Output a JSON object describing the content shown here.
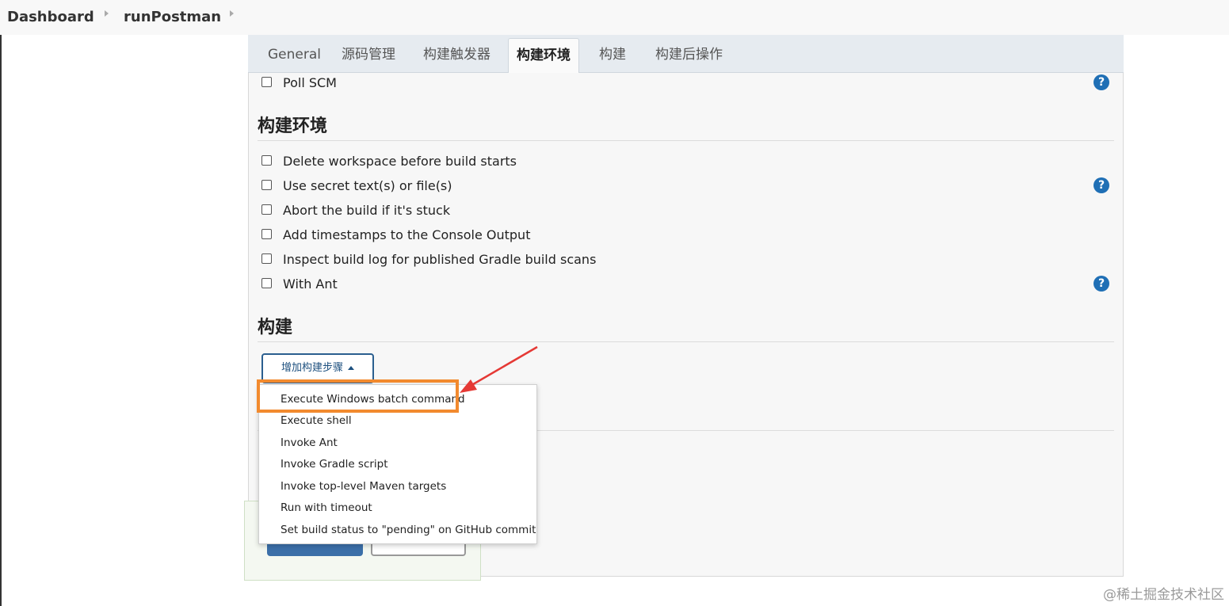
{
  "breadcrumb": {
    "items": [
      "Dashboard",
      "runPostman"
    ]
  },
  "tabs": [
    {
      "label": "General",
      "active": false
    },
    {
      "label": "源码管理",
      "active": false
    },
    {
      "label": "构建触发器",
      "active": false
    },
    {
      "label": "构建环境",
      "active": true
    },
    {
      "label": "构建",
      "active": false
    },
    {
      "label": "构建后操作",
      "active": false
    }
  ],
  "triggers": {
    "poll_scm": {
      "label": "Poll SCM",
      "checked": false
    }
  },
  "build_env": {
    "title": "构建环境",
    "options": [
      {
        "label": "Delete workspace before build starts",
        "checked": false
      },
      {
        "label": "Use secret text(s) or file(s)",
        "checked": false
      },
      {
        "label": "Abort the build if it's stuck",
        "checked": false
      },
      {
        "label": "Add timestamps to the Console Output",
        "checked": false
      },
      {
        "label": "Inspect build log for published Gradle build scans",
        "checked": false
      },
      {
        "label": "With Ant",
        "checked": false
      }
    ]
  },
  "build": {
    "title": "构建",
    "add_step_label": "增加构建步骤",
    "menu_items": [
      "Execute Windows batch command",
      "Execute shell",
      "Invoke Ant",
      "Invoke Gradle script",
      "Invoke top-level Maven targets",
      "Run with timeout",
      "Set build status to \"pending\" on GitHub commit"
    ],
    "highlighted_item": "Execute Windows batch command"
  },
  "help_glyph": "?",
  "watermark": "@稀土掘金技术社区",
  "colors": {
    "accent": "#1f6fb5",
    "highlight": "#f28a2e",
    "arrow": "#e53935"
  }
}
